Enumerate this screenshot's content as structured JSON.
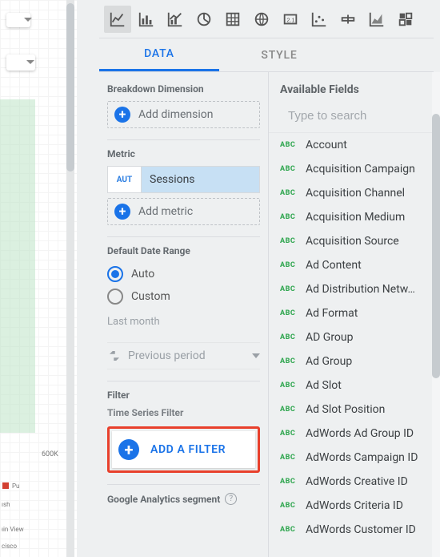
{
  "tabs": {
    "data": "DATA",
    "style": "STYLE"
  },
  "sections": {
    "breakdown_dimension": "Breakdown Dimension",
    "add_dimension": "Add dimension",
    "metric": "Metric",
    "aut_badge": "AUT",
    "sessions": "Sessions",
    "add_metric": "Add metric",
    "default_date_range": "Default Date Range",
    "auto": "Auto",
    "custom": "Custom",
    "last_month": "Last month",
    "previous_period": "Previous period",
    "filter": "Filter",
    "time_series_filter": "Time Series Filter",
    "add_filter": "ADD A FILTER",
    "ga_segment": "Google Analytics segment"
  },
  "fields_panel": {
    "title": "Available Fields",
    "search_placeholder": "Type to search",
    "items": [
      "Account",
      "Acquisition Campaign",
      "Acquisition Channel",
      "Acquisition Medium",
      "Acquisition Source",
      "Ad Content",
      "Ad Distribution Netw…",
      "Ad Format",
      "AD Group",
      "Ad Group",
      "Ad Slot",
      "Ad Slot Position",
      "AdWords Ad Group ID",
      "AdWords Campaign ID",
      "AdWords Creative ID",
      "AdWords Criteria ID",
      "AdWords Customer ID"
    ]
  },
  "canvas": {
    "tick600k": "600K",
    "legend_pu": "Pu",
    "legend_sh": "ısh",
    "legend_view": "ıin View",
    "legend_cisco": "cisco"
  }
}
